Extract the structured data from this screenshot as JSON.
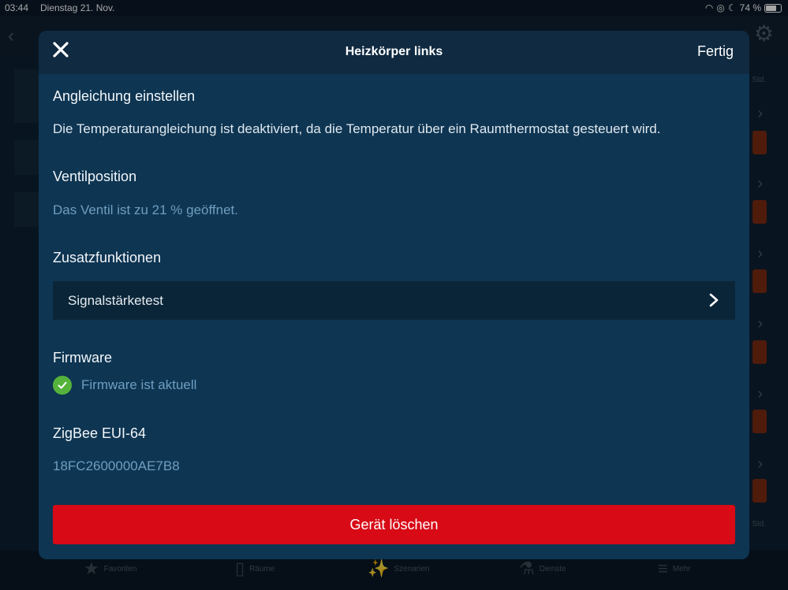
{
  "status_bar": {
    "time": "03:44",
    "date": "Dienstag 21. Nov.",
    "battery": "74 %",
    "battery_level": 0.74
  },
  "background": {
    "std_label": "Std.",
    "tabs": [
      {
        "label": "Favoriten",
        "icon": "star-icon"
      },
      {
        "label": "Räume",
        "icon": "door-icon"
      },
      {
        "label": "Szenarien",
        "icon": "wand-icon"
      },
      {
        "label": "Dienste",
        "icon": "flask-icon"
      },
      {
        "label": "Mehr",
        "icon": "layers-icon"
      }
    ]
  },
  "modal": {
    "title": "Heizkörper links",
    "done_label": "Fertig",
    "adjustment": {
      "title": "Angleichung einstellen",
      "text": "Die Temperaturangleichung ist deaktiviert, da die Temperatur über ein Raumthermostat gesteuert wird."
    },
    "valve": {
      "title": "Ventilposition",
      "text": "Das Ventil ist zu 21 % geöffnet."
    },
    "extras": {
      "title": "Zusatzfunktionen",
      "signal_test_label": "Signalstärketest"
    },
    "firmware": {
      "title": "Firmware",
      "status": "Firmware ist aktuell"
    },
    "zigbee": {
      "title": "ZigBee EUI-64",
      "value": "18FC2600000AE7B8"
    },
    "delete_label": "Gerät löschen"
  },
  "colors": {
    "modal_bg": "#0e3552",
    "header_bg": "#0f2a41",
    "muted_text": "#6f9ec0",
    "delete_red": "#d70a16",
    "check_green": "#55b33b"
  }
}
